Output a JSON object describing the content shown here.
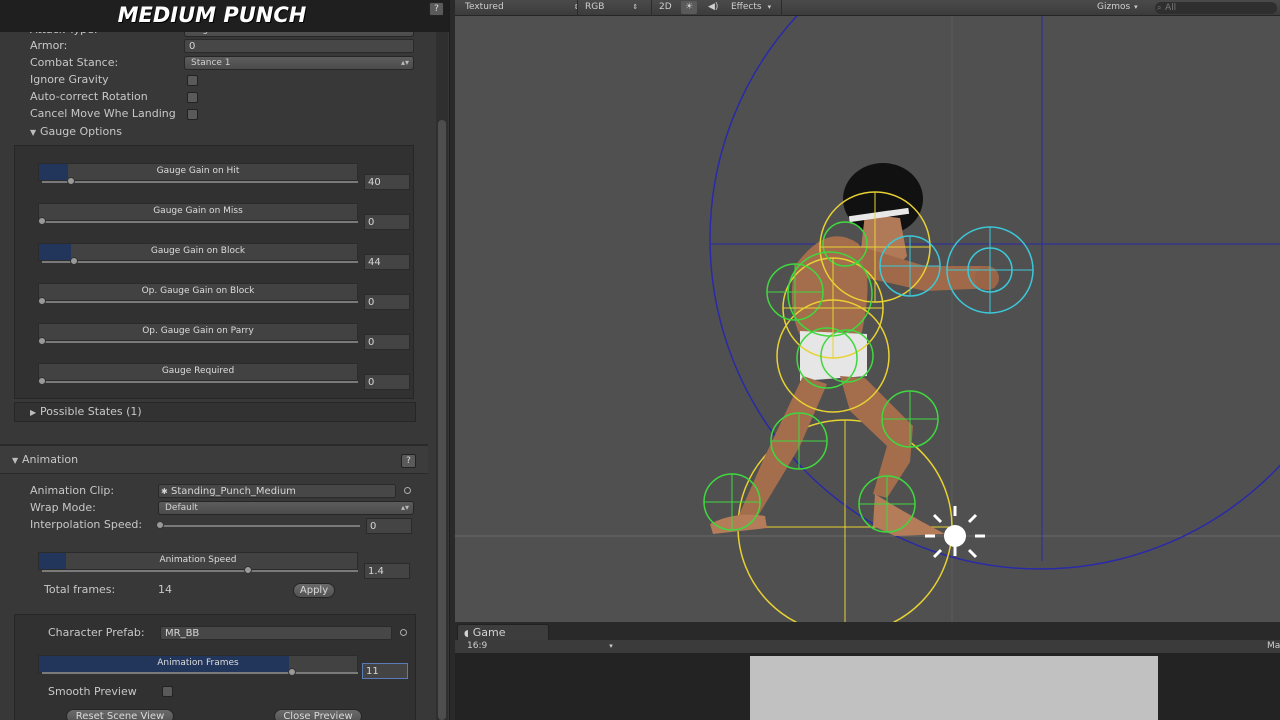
{
  "inspector": {
    "title": "MEDIUM PUNCH",
    "attack_type_label": "Attack Type:",
    "attack_type_value": "Regular",
    "armor_label": "Armor:",
    "armor_value": "0",
    "combat_stance_label": "Combat Stance:",
    "combat_stance_value": "Stance 1",
    "ignore_gravity_label": "Ignore Gravity",
    "auto_correct_label": "Auto-correct Rotation",
    "cancel_move_label": "Cancel Move Whe Landing",
    "gauge_options_label": "Gauge Options",
    "gauge_sliders": [
      {
        "label": "Gauge Gain on Hit",
        "value": "40",
        "fill": 0.09
      },
      {
        "label": "Gauge Gain on Miss",
        "value": "0",
        "fill": 0.0
      },
      {
        "label": "Gauge Gain on Block",
        "value": "44",
        "fill": 0.1
      },
      {
        "label": "Op. Gauge Gain on Block",
        "value": "0",
        "fill": 0.0
      },
      {
        "label": "Op. Gauge Gain on Parry",
        "value": "0",
        "fill": 0.0
      },
      {
        "label": "Gauge Required",
        "value": "0",
        "fill": 0.0
      }
    ],
    "possible_states_label": "Possible States (1)"
  },
  "animation": {
    "header_label": "Animation",
    "clip_label": "Animation Clip:",
    "clip_value": "Standing_Punch_Medium",
    "wrap_mode_label": "Wrap Mode:",
    "wrap_mode_value": "Default",
    "interp_speed_label": "Interpolation Speed:",
    "interp_speed_value": "0",
    "anim_speed_label": "Animation Speed",
    "anim_speed_value": "1.4",
    "anim_speed_fill": 0.28,
    "total_frames_label": "Total frames:",
    "total_frames_value": "14",
    "apply_label": "Apply",
    "prefab_label": "Character Prefab:",
    "prefab_value": "MR_BB",
    "anim_frames_label": "Animation Frames",
    "anim_frames_value": "11",
    "anim_frames_fill": 0.78,
    "smooth_preview_label": "Smooth Preview",
    "reset_scene_label": "Reset Scene View",
    "close_preview_label": "Close Preview"
  },
  "scene_toolbar": {
    "shading": "Textured",
    "channel": "RGB",
    "mode_2d": "2D",
    "effects": "Effects",
    "gizmos": "Gizmos",
    "search_placeholder": "All"
  },
  "game": {
    "tab_label": "Game",
    "aspect": "16:9",
    "right_label": "Ma"
  },
  "colors": {
    "hitbox_green": "#3fd83f",
    "hurtbox_yellow": "#e8d232",
    "attack_cyan": "#3cc8d8",
    "guide_blue": "#2a2aa8",
    "slider_fill": "#22365c"
  }
}
